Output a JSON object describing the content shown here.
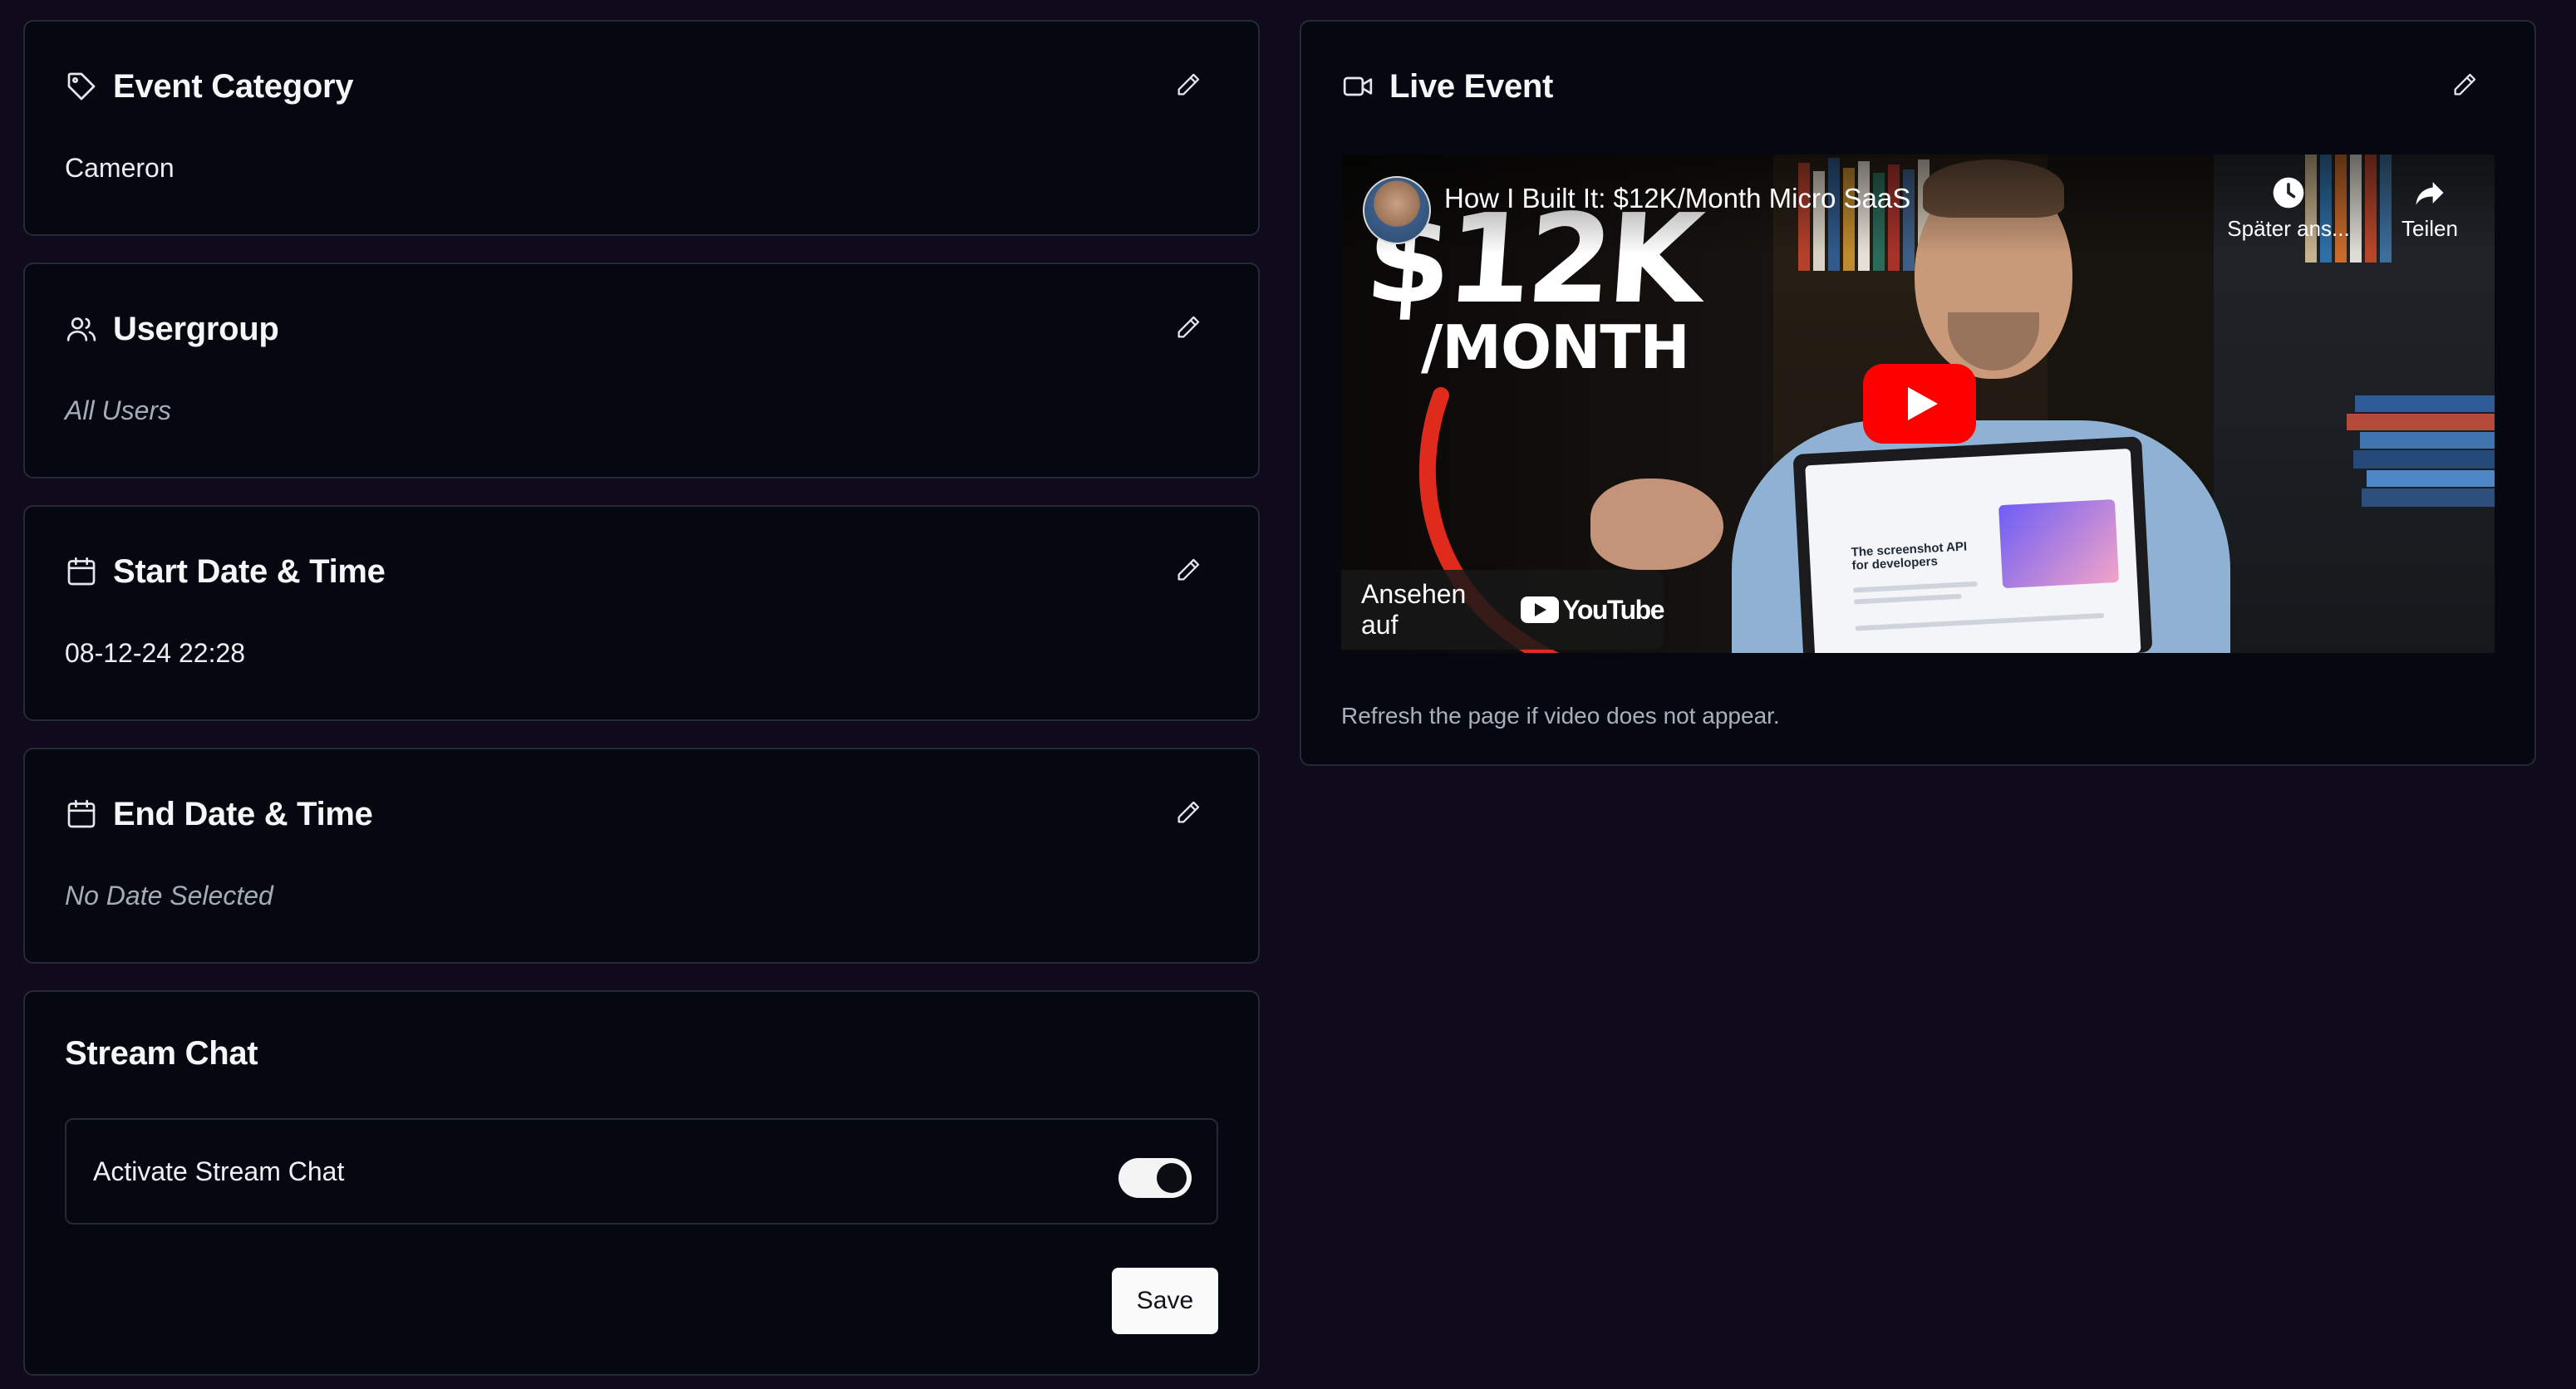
{
  "event_category": {
    "title": "Event Category",
    "value": "Cameron",
    "icon": "tag-icon",
    "edit_icon": "pencil-icon"
  },
  "usergroup": {
    "title": "Usergroup",
    "value": "All Users",
    "icon": "users-icon",
    "edit_icon": "pencil-icon"
  },
  "start_datetime": {
    "title": "Start Date & Time",
    "value": "08-12-24 22:28",
    "icon": "calendar-icon",
    "edit_icon": "pencil-icon"
  },
  "end_datetime": {
    "title": "End Date & Time",
    "value": "No Date Selected",
    "icon": "calendar-icon",
    "edit_icon": "pencil-icon"
  },
  "stream_chat": {
    "title": "Stream Chat",
    "toggle_label": "Activate Stream Chat",
    "toggle_on": true,
    "save_label": "Save"
  },
  "live_event": {
    "title": "Live Event",
    "icon": "video-camera-icon",
    "edit_icon": "pencil-icon",
    "video": {
      "title": "How I Built It: $12K/Month Micro SaaS",
      "thumbnail_headline": "$12K",
      "thumbnail_subline": "/MONTH",
      "laptop_screen_text": "The screenshot API for developers",
      "watch_later_label": "Später ans...",
      "share_label": "Teilen",
      "watch_on_label": "Ansehen auf",
      "platform_name": "YouTube"
    },
    "note": "Refresh the page if video does not appear."
  },
  "colors": {
    "page_background": "#0f0a1c",
    "card_background": "#050810",
    "card_border": "#252a36",
    "youtube_red": "#ff0000"
  }
}
